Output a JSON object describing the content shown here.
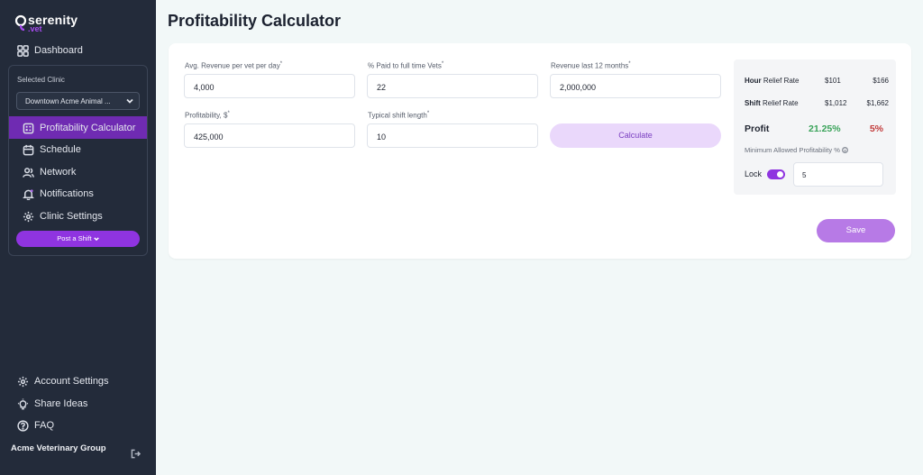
{
  "brand": {
    "name": "serenity",
    "sub": ".vet"
  },
  "sidebar": {
    "dashboard": "Dashboard",
    "selected_clinic_label": "Selected Clinic",
    "clinic_value": "Downtown Acme Animal ...",
    "items": [
      {
        "label": "Profitability Calculator",
        "icon": "calculator-icon"
      },
      {
        "label": "Schedule",
        "icon": "calendar-icon"
      },
      {
        "label": "Network",
        "icon": "users-icon"
      },
      {
        "label": "Notifications",
        "icon": "bell-icon"
      },
      {
        "label": "Clinic Settings",
        "icon": "gear-icon"
      }
    ],
    "post_shift": "Post a Shift",
    "bottom": [
      {
        "label": "Account Settings",
        "icon": "gear-icon"
      },
      {
        "label": "Share Ideas",
        "icon": "lightbulb-icon"
      },
      {
        "label": "FAQ",
        "icon": "question-icon"
      }
    ],
    "org_name": "Acme Veterinary Group"
  },
  "page": {
    "title": "Profitability Calculator"
  },
  "form": {
    "avg_revenue": {
      "label": "Avg. Revenue per vet per day",
      "value": "4,000"
    },
    "paid_pct": {
      "label": "% Paid to full time Vets",
      "value": "22"
    },
    "revenue_12m": {
      "label": "Revenue last 12 months",
      "value": "2,000,000"
    },
    "profitability": {
      "label": "Profitability, $",
      "value": "425,000"
    },
    "shift_length": {
      "label": "Typical shift length",
      "value": "10"
    },
    "required_mark": "*",
    "calculate": "Calculate"
  },
  "results": {
    "hour": {
      "bold": "Hour",
      "rest": " Relief Rate",
      "v1": "$101",
      "v2": "$166"
    },
    "shift": {
      "bold": "Shift",
      "rest": " Relief Rate",
      "v1": "$1,012",
      "v2": "$1,662"
    },
    "profit_label": "Profit",
    "profit_value": "21.25%",
    "profit_min": "5%",
    "min_label": "Minimum Allowed Profitability %",
    "lock_label": "Lock",
    "lock_on": true,
    "lock_value": "5"
  },
  "save": "Save",
  "colors": {
    "sidebar": "#232b3a",
    "accent": "#8f34e0",
    "active": "#6f2bb2",
    "green": "#3aa35a",
    "red": "#c23a3a"
  }
}
